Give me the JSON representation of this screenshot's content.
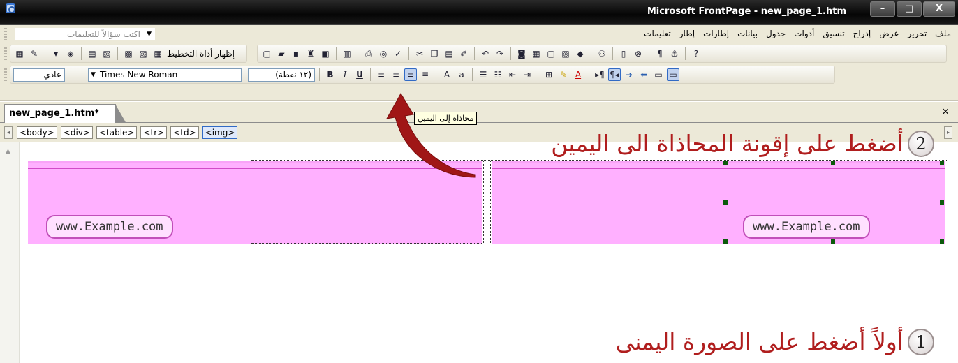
{
  "window": {
    "title": "Microsoft FrontPage - new_page_1.htm",
    "buttons": [
      "–",
      "□",
      "X"
    ]
  },
  "menubar": {
    "items": [
      "ملف",
      "تحرير",
      "عرض",
      "إدراج",
      "تنسيق",
      "أدوات",
      "جدول",
      "بيانات",
      "إطارات",
      "إطار",
      "تعليمات"
    ],
    "ask_placeholder": "اكتب سؤالاً للتعليمات"
  },
  "toolbar": {
    "layout_tool_label": "إظهار أداة التخطيط",
    "style_value": "عادي",
    "font_value": "Times New Roman",
    "size_value": "(١٢ نقطة)"
  },
  "tabs": {
    "document": "new_page_1.htm*",
    "close": "×"
  },
  "tooltip": "محاذاة إلى اليمين",
  "tagbar": {
    "tags": [
      "<body>",
      "<div>",
      "<table>",
      "<tr>",
      "<td>",
      "<img>"
    ]
  },
  "editor": {
    "left_url": "www.Example.com",
    "right_url": "www.Example.com"
  },
  "annotations": {
    "step2_number": "2",
    "step2_text": "أضغط على إقونة المحاذاة الى اليمين",
    "step1_number": "1",
    "step1_text": "أولاً أضغط على الصورة اليمنى"
  },
  "colors": {
    "cell_fill": "#ffb0ff",
    "annotation_red": "#b01e1e",
    "selection_blue": "#316ac5"
  }
}
